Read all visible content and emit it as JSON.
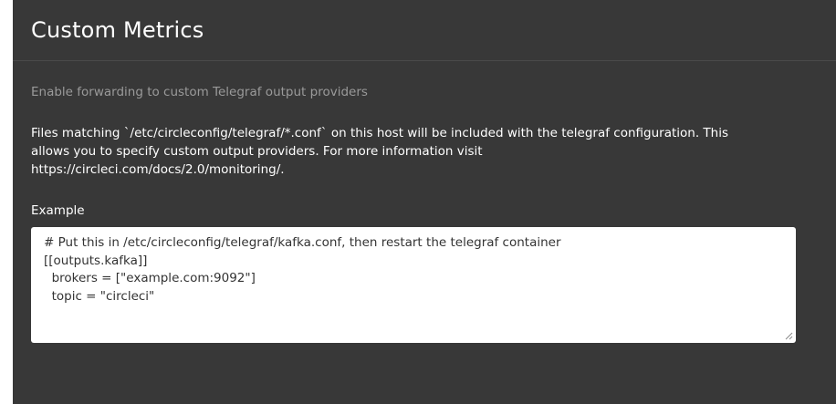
{
  "section": {
    "title": "Custom Metrics",
    "subtitle": "Enable forwarding to custom Telegraf output providers",
    "description_lines": [
      "Files matching `/etc/circleconfig/telegraf/*.conf` on this host will be included with the telegraf configuration. This",
      "allows you to specify custom output providers. For more information visit",
      "https://circleci.com/docs/2.0/monitoring/."
    ],
    "example_label": "Example",
    "example_lines": [
      "# Put this in /etc/circleconfig/telegraf/kafka.conf, then restart the telegraf container",
      "[[outputs.kafka]]",
      "  brokers = [\"example.com:9092\"]",
      "  topic = \"circleci\""
    ]
  },
  "icons": {
    "resize_handle": "resize-grip-icon"
  },
  "colors": {
    "panel_background": "#383838",
    "subtitle_text": "#9a9a9a",
    "editor_background": "#ffffff",
    "editor_text": "#333333"
  }
}
